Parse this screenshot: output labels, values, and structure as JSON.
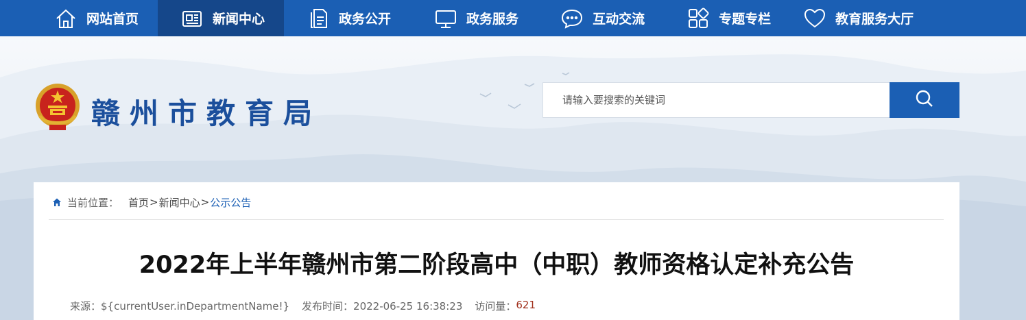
{
  "nav": {
    "items": [
      {
        "label": "网站首页",
        "icon": "home-icon"
      },
      {
        "label": "新闻中心",
        "icon": "newspaper-icon",
        "active": true
      },
      {
        "label": "政务公开",
        "icon": "document-icon"
      },
      {
        "label": "政务服务",
        "icon": "monitor-icon"
      },
      {
        "label": "互动交流",
        "icon": "chat-icon"
      },
      {
        "label": "专题专栏",
        "icon": "grid-icon"
      },
      {
        "label": "教育服务大厅",
        "icon": "heart-icon"
      }
    ]
  },
  "header": {
    "site_title": "赣州市教育局",
    "search_placeholder": "请输入要搜索的关键词"
  },
  "breadcrumb": {
    "label": "当前位置：",
    "items": [
      "首页",
      "新闻中心",
      "公示公告"
    ],
    "separator": ">"
  },
  "article": {
    "title": "2022年上半年赣州市第二阶段高中（中职）教师资格认定补充公告",
    "source": "来源：${currentUser.inDepartmentName!}",
    "published": "发布时间：2022-06-25 16:38:23",
    "views_label": "访问量：",
    "views": "621"
  },
  "colors": {
    "nav_bg": "#1b5fb4",
    "nav_active": "#15478a",
    "title_blue": "#1b4f9c",
    "views_red": "#a0301c"
  }
}
